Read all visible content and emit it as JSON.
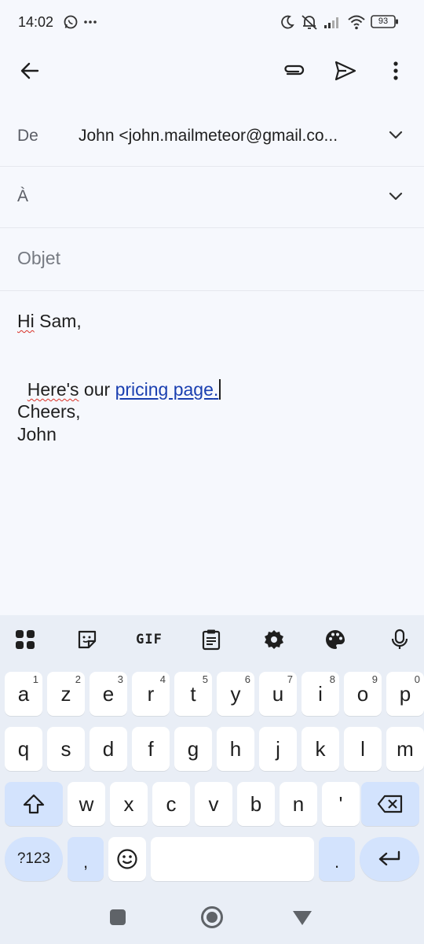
{
  "status_bar": {
    "time": "14:02",
    "battery": "93",
    "icons": [
      "whatsapp-icon",
      "more-dots-icon",
      "moon-icon",
      "muted-bell-icon",
      "signal-icon",
      "wifi-icon",
      "battery-icon"
    ]
  },
  "app_bar": {
    "back_icon": "arrow-back-icon",
    "attach_icon": "paperclip-icon",
    "send_icon": "send-icon",
    "menu_icon": "more-vert-icon"
  },
  "compose": {
    "from_label": "De",
    "from_value": "John <john.mailmeteor@gmail.co...",
    "to_label": "À",
    "subject_placeholder": "Objet",
    "body": {
      "greeting_word": "Hi",
      "greeting_rest": " Sam,",
      "line2_word": "Here's",
      "line2_mid": " our ",
      "link_text": "pricing page",
      "line2_end": ".",
      "closing": "Cheers,",
      "signature": "John"
    }
  },
  "keyboard": {
    "toolbar": [
      "apps-grid-icon",
      "sticker-icon",
      "gif-icon",
      "clipboard-icon",
      "settings-icon",
      "palette-icon",
      "mic-icon"
    ],
    "gif_label": "GIF",
    "row1": [
      {
        "k": "a",
        "h": "1"
      },
      {
        "k": "z",
        "h": "2"
      },
      {
        "k": "e",
        "h": "3"
      },
      {
        "k": "r",
        "h": "4"
      },
      {
        "k": "t",
        "h": "5"
      },
      {
        "k": "y",
        "h": "6"
      },
      {
        "k": "u",
        "h": "7"
      },
      {
        "k": "i",
        "h": "8"
      },
      {
        "k": "o",
        "h": "9"
      },
      {
        "k": "p",
        "h": "0"
      }
    ],
    "row2": [
      "q",
      "s",
      "d",
      "f",
      "g",
      "h",
      "j",
      "k",
      "l",
      "m"
    ],
    "row3": [
      "w",
      "x",
      "c",
      "v",
      "b",
      "n",
      "'"
    ],
    "sym_label": "?123",
    "comma": ",",
    "period": "."
  },
  "colors": {
    "background": "#f6f8fd",
    "keyboard_bg": "#e9eef6",
    "key_special": "#d3e3fd",
    "link": "#1a3fb0",
    "spellcheck": "#d93025"
  }
}
